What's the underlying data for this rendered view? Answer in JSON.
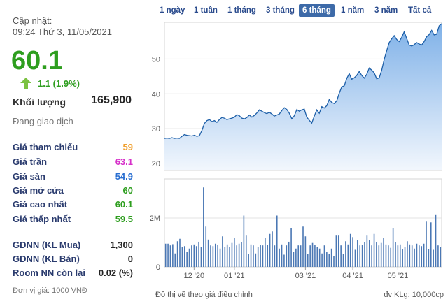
{
  "info": {
    "update_label": "Cập nhật:",
    "update_time": "09:24 Thứ 3, 11/05/2021",
    "price": "60.1",
    "change": "1.1 (1.9%)",
    "volume_label": "Khối lượng",
    "volume_value": "165,900",
    "trading_status": "Đang giao dịch",
    "unit_note": "Đơn vị giá: 1000 VNĐ",
    "colors": {
      "up": "#2e9e1f",
      "reference": "#f0a030",
      "ceiling": "#d631c9",
      "floor": "#2a6fd1",
      "label": "#2a3b6e"
    },
    "rows": [
      {
        "label": "Giá tham chiếu",
        "value": "59",
        "color": "#f0a030"
      },
      {
        "label": "Giá trần",
        "value": "63.1",
        "color": "#d631c9"
      },
      {
        "label": "Giá sàn",
        "value": "54.9",
        "color": "#2a6fd1"
      },
      {
        "label": "Giá mở cửa",
        "value": "60",
        "color": "#2e9e1f"
      },
      {
        "label": "Giá cao nhất",
        "value": "60.1",
        "color": "#2e9e1f"
      },
      {
        "label": "Giá thấp nhất",
        "value": "59.5",
        "color": "#2e9e1f"
      }
    ],
    "foreign_rows": [
      {
        "label": "GDNN (KL Mua)",
        "value": "1,300",
        "color": "#222222"
      },
      {
        "label": "GDNN (KL Bán)",
        "value": "0",
        "color": "#222222"
      },
      {
        "label": "Room NN còn lại",
        "value": "0.02 (%)",
        "color": "#222222"
      }
    ]
  },
  "tabs": [
    {
      "label": "1 ngày"
    },
    {
      "label": "1 tuần"
    },
    {
      "label": "1 tháng"
    },
    {
      "label": "3 tháng"
    },
    {
      "label": "6 tháng",
      "active": true
    },
    {
      "label": "1 năm"
    },
    {
      "label": "3 năm"
    },
    {
      "label": "Tất cả"
    }
  ],
  "chart_data": {
    "type": "area",
    "price_axis": {
      "ticks": [
        20,
        30,
        40,
        50
      ],
      "range": [
        18,
        60.5
      ]
    },
    "volume_axis": {
      "ticks": [
        {
          "value": 0,
          "label": "0"
        },
        {
          "value": 2000000,
          "label": "2M"
        }
      ],
      "range": [
        0,
        3600000
      ]
    },
    "x_ticks": [
      "12 '20",
      "01 '21",
      "03 '21",
      "04 '21",
      "05 '21"
    ],
    "x_tick_index": [
      12,
      29,
      59,
      79,
      98
    ],
    "price_series": [
      27.2,
      27.3,
      27.2,
      27.4,
      27.2,
      27.3,
      27.2,
      27.8,
      28.3,
      28.1,
      28.0,
      27.9,
      28.1,
      27.8,
      28.0,
      29.5,
      31.5,
      32.3,
      32.6,
      32.0,
      32.3,
      31.8,
      32.6,
      33.2,
      33.0,
      32.6,
      32.8,
      33.0,
      33.3,
      34.0,
      33.7,
      33.0,
      32.8,
      33.2,
      33.9,
      33.3,
      33.8,
      34.5,
      35.4,
      35.0,
      34.6,
      34.3,
      34.7,
      34.2,
      33.6,
      33.9,
      34.2,
      35.2,
      36.0,
      35.5,
      34.4,
      32.8,
      33.7,
      35.5,
      35.0,
      35.4,
      35.6,
      33.3,
      32.4,
      31.6,
      33.6,
      35.4,
      34.4,
      36.3,
      35.9,
      36.6,
      38.4,
      37.5,
      37.2,
      38.0,
      40.2,
      42.0,
      42.3,
      44.4,
      45.8,
      44.2,
      44.6,
      45.3,
      46.4,
      45.3,
      44.5,
      45.6,
      47.4,
      46.8,
      46.0,
      44.3,
      44.6,
      46.8,
      49.9,
      52.4,
      54.7,
      55.8,
      56.7,
      55.6,
      55.0,
      56.2,
      57.8,
      55.9,
      54.0,
      53.7,
      54.1,
      54.7,
      54.3,
      54.0,
      55.0,
      56.4,
      57.0,
      58.2,
      56.9,
      57.1,
      59.5,
      60.1
    ],
    "volume_series": [
      0.95,
      0.95,
      0.88,
      0.93,
      0.55,
      1.05,
      1.15,
      0.8,
      0.85,
      0.6,
      0.75,
      0.88,
      0.92,
      0.85,
      1.03,
      0.82,
      3.25,
      1.65,
      1.12,
      0.88,
      0.85,
      0.95,
      0.9,
      0.75,
      1.25,
      0.82,
      0.92,
      0.82,
      0.98,
      1.18,
      0.88,
      0.95,
      1.02,
      2.1,
      1.28,
      0.52,
      0.92,
      0.88,
      0.55,
      0.82,
      0.9,
      0.88,
      1.18,
      0.9,
      1.35,
      1.45,
      0.88,
      2.1,
      0.75,
      0.92,
      0.5,
      0.88,
      1.03,
      1.58,
      0.6,
      0.75,
      0.88,
      0.88,
      1.65,
      1.25,
      0.52,
      0.88,
      0.98,
      0.9,
      0.82,
      0.75,
      0.55,
      0.88,
      0.62,
      0.52,
      0.75,
      0.45,
      1.28,
      1.28,
      0.88,
      0.52,
      1.05,
      0.92,
      1.35,
      1.22,
      0.7,
      1.1,
      0.88,
      0.9,
      1.02,
      1.28,
      1.1,
      0.88,
      1.35,
      1.02,
      0.88,
      0.98,
      1.2,
      0.92,
      0.88,
      0.78,
      1.58,
      1.02,
      0.88,
      0.92,
      0.72,
      0.82,
      1.05,
      0.92,
      0.88,
      0.75,
      0.95,
      0.88,
      0.85,
      0.95,
      1.85,
      0.72,
      1.82,
      0.7,
      2.12,
      0.88,
      0.82
    ]
  },
  "footer": {
    "adjusted_note": "Đồ thị vẽ theo giá điều chỉnh",
    "volume_unit": "đv KLg: 10,000cp"
  }
}
